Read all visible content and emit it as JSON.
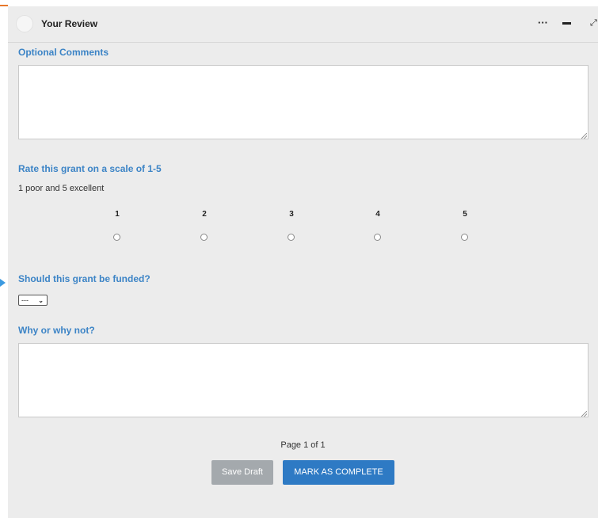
{
  "panel": {
    "title": "Your Review",
    "controls": {
      "more_label": "···",
      "expand_label": "⤢"
    }
  },
  "form": {
    "optional_comments": {
      "label": "Optional Comments",
      "value": ""
    },
    "rating": {
      "label": "Rate this grant on a scale of 1-5",
      "hint": "1 poor and 5 excellent",
      "options": [
        "1",
        "2",
        "3",
        "4",
        "5"
      ],
      "selected": null
    },
    "funded": {
      "label": "Should this grant be funded?",
      "selected_value": "---"
    },
    "reason": {
      "label": "Why or why not?",
      "value": ""
    }
  },
  "footer": {
    "page_indicator": "Page 1 of 1",
    "save_draft_label": "Save Draft",
    "complete_label": "MARK AS COMPLETE"
  },
  "colors": {
    "accent_orange": "#e8782a",
    "label_blue": "#3c84c6",
    "primary_button": "#2e7ac4",
    "secondary_button": "#a4a9ad",
    "panel_background": "#ececec"
  }
}
